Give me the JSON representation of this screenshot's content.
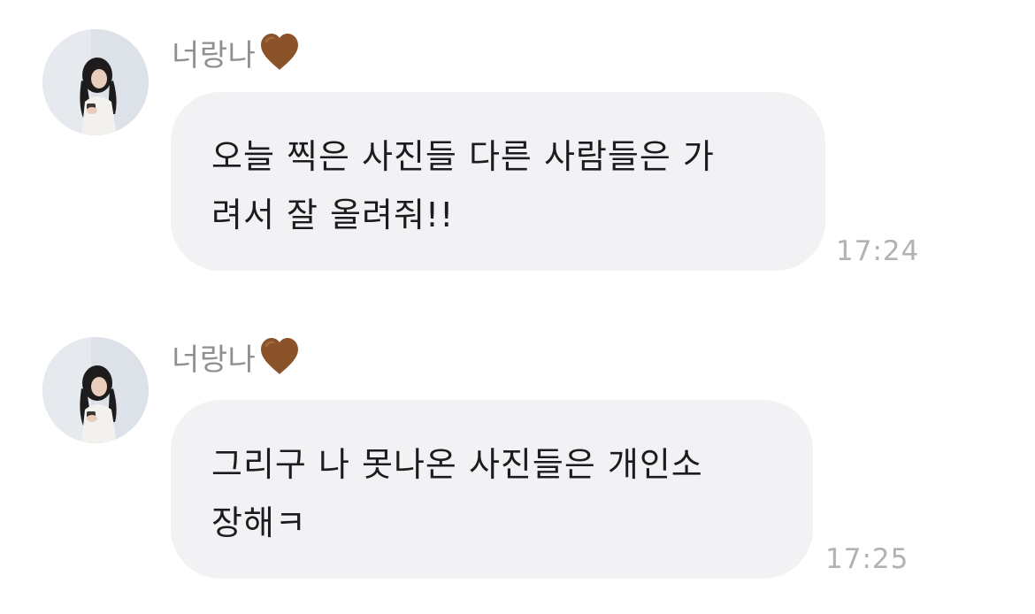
{
  "messages": [
    {
      "sender": "너랑나",
      "lines": [
        "오늘 찍은 사진들 다른 사람들은 가",
        "려서 잘 올려줘!!"
      ],
      "time": "17:24"
    },
    {
      "sender": "너랑나",
      "lines": [
        "그리구 나 못나온 사진들은 개인소",
        "장해ㅋ"
      ],
      "time": "17:25"
    }
  ],
  "icons": {
    "sender_badge": "brown-heart-icon",
    "avatar": "profile-photo"
  },
  "colors": {
    "bubble": "#f2f2f4",
    "text": "#1c1c1e",
    "sender_name": "#8e8e93",
    "timestamp": "#b1b1b6",
    "heart": "#8b5329"
  }
}
